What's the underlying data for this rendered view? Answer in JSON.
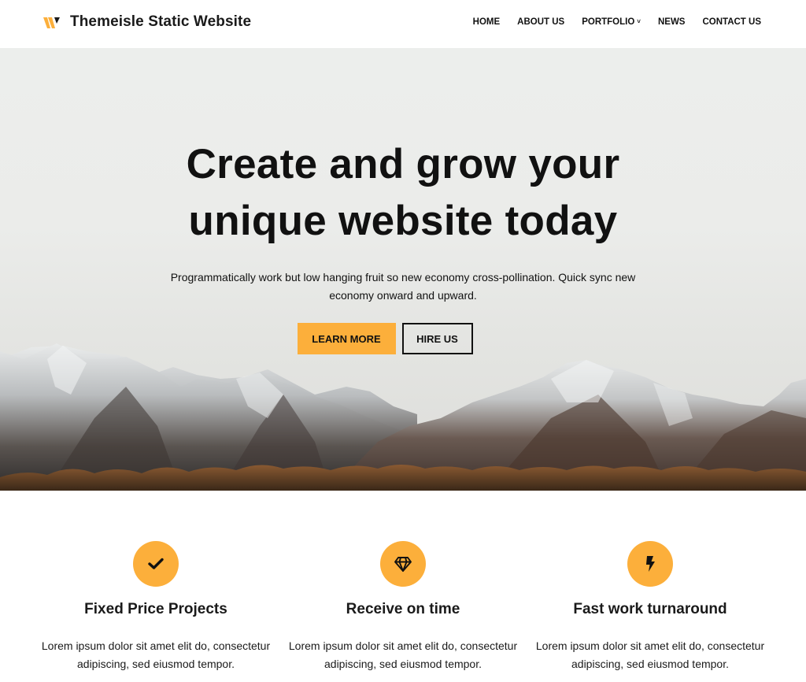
{
  "header": {
    "site_title": "Themeisle Static Website",
    "logo_icon": "themeisle-w-logo",
    "brand_color": "#fcaf3b",
    "nav": [
      {
        "label": "HOME"
      },
      {
        "label": "ABOUT US"
      },
      {
        "label": "PORTFOLIO",
        "has_dropdown": true,
        "caret": "˅"
      },
      {
        "label": "NEWS"
      },
      {
        "label": "CONTACT US"
      }
    ]
  },
  "hero": {
    "title_line1": "Create and grow your",
    "title_line2": "unique website today",
    "subtitle": "Programmatically work but low hanging fruit so new economy cross-pollination. Quick sync new economy onward and upward.",
    "primary_button": "LEARN MORE",
    "secondary_button": "HIRE US",
    "background_image": "snowy-mountain-range"
  },
  "features": [
    {
      "icon": "checkmark-icon",
      "title": "Fixed Price Projects",
      "text": "Lorem ipsum dolor sit amet elit do, consectetur adipiscing, sed eiusmod tempor."
    },
    {
      "icon": "diamond-icon",
      "title": "Receive on time",
      "text": "Lorem ipsum dolor sit amet elit do, consectetur adipiscing, sed eiusmod tempor."
    },
    {
      "icon": "lightning-bolt-icon",
      "title": "Fast work turnaround",
      "text": "Lorem ipsum dolor sit amet elit do, consectetur adipiscing, sed eiusmod tempor."
    }
  ]
}
